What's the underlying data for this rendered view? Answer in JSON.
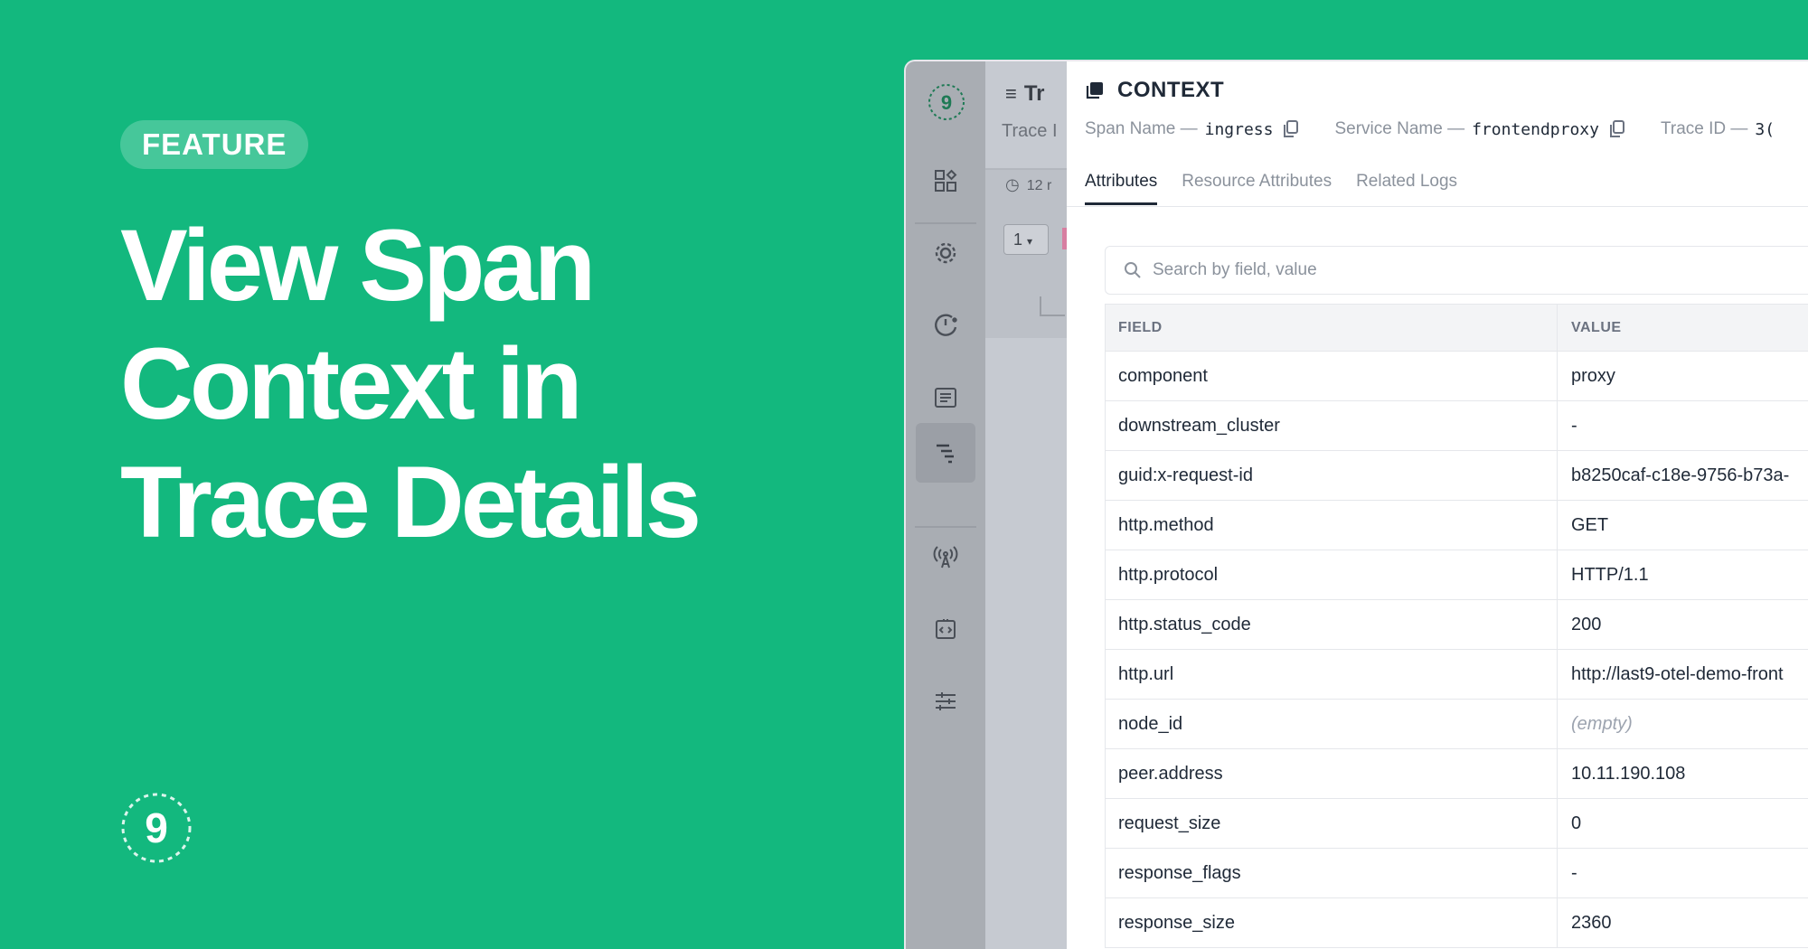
{
  "hero": {
    "badge": "FEATURE",
    "headline_lines": [
      "View Span",
      "Context in",
      "Trace Details"
    ],
    "brand_glyph": "9"
  },
  "rail": {
    "logo_glyph": "9",
    "icons": [
      "dashboard-icon",
      "settings-gear-icon",
      "alert-gauge-icon",
      "logs-icon",
      "traces-icon",
      "broadcast-icon",
      "code-icon",
      "sliders-icon"
    ],
    "active": "traces-icon"
  },
  "background_panel": {
    "title_fragment": "Tr",
    "subtitle_fragment": "Trace I",
    "duration_fragment": "12 r",
    "select_value": "1"
  },
  "context": {
    "title": "CONTEXT",
    "span_name_label": "Span Name —",
    "span_name": "ingress",
    "service_name_label": "Service Name —",
    "service_name": "frontendproxy",
    "trace_id_label": "Trace ID —",
    "trace_id": "3(",
    "tabs": [
      {
        "label": "Attributes",
        "active": true
      },
      {
        "label": "Resource Attributes",
        "active": false
      },
      {
        "label": "Related Logs",
        "active": false
      }
    ],
    "search_placeholder": "Search by field, value",
    "table": {
      "headers": [
        "FIELD",
        "VALUE"
      ],
      "rows": [
        {
          "field": "component",
          "value": "proxy"
        },
        {
          "field": "downstream_cluster",
          "value": "-"
        },
        {
          "field": "guid:x-request-id",
          "value": "b8250caf-c18e-9756-b73a-"
        },
        {
          "field": "http.method",
          "value": "GET"
        },
        {
          "field": "http.protocol",
          "value": "HTTP/1.1"
        },
        {
          "field": "http.status_code",
          "value": "200"
        },
        {
          "field": "http.url",
          "value": "http://last9-otel-demo-front"
        },
        {
          "field": "node_id",
          "value": "(empty)"
        },
        {
          "field": "peer.address",
          "value": "10.11.190.108"
        },
        {
          "field": "request_size",
          "value": "0"
        },
        {
          "field": "response_flags",
          "value": "-"
        },
        {
          "field": "response_size",
          "value": "2360"
        }
      ]
    }
  },
  "colors": {
    "background": "#13b87e",
    "rail": "#a9adb3",
    "panel": "#ffffff",
    "text": "#1f2937",
    "muted": "#8b929c"
  }
}
